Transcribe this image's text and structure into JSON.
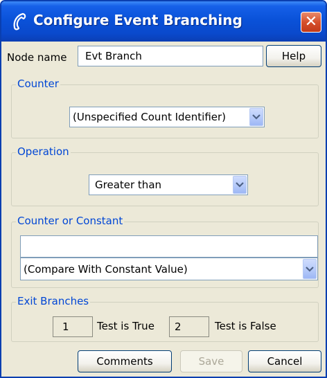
{
  "window": {
    "title": "Configure Event Branching",
    "icon": "phone-handset-icon",
    "close_glyph": "✕"
  },
  "node": {
    "label": "Node name",
    "value": "Evt Branch",
    "help_label": "Help"
  },
  "counter": {
    "legend": "Counter",
    "selected": "(Unspecified Count Identifier)"
  },
  "operation": {
    "legend": "Operation",
    "selected": "Greater than"
  },
  "counter_or_constant": {
    "legend": "Counter or Constant",
    "value": "",
    "selected": "(Compare With Constant Value)"
  },
  "exit_branches": {
    "legend": "Exit Branches",
    "true_index": "1",
    "true_label": "Test is True",
    "false_index": "2",
    "false_label": "Test is False"
  },
  "buttons": {
    "comments": "Comments",
    "save": "Save",
    "cancel": "Cancel"
  },
  "colors": {
    "titlebar": "#0a52d9",
    "legend_text": "#0046d5",
    "dialog_bg": "#ece9d8"
  }
}
